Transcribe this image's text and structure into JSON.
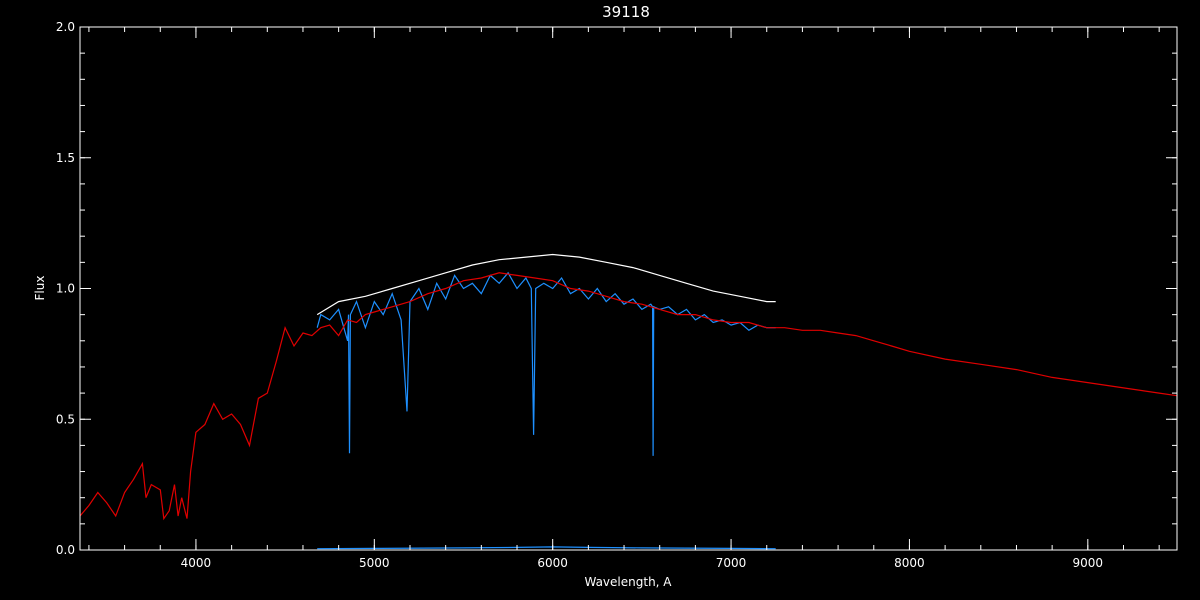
{
  "chart_data": {
    "type": "line",
    "title": "39118",
    "xlabel": "Wavelength, A",
    "ylabel": "Flux",
    "xlim": [
      3350,
      9500
    ],
    "ylim": [
      0.0,
      2.0
    ],
    "x_ticks": [
      4000,
      5000,
      6000,
      7000,
      8000,
      9000
    ],
    "x_tick_labels": [
      "4000",
      "5000",
      "6000",
      "7000",
      "8000",
      "9000"
    ],
    "x_minor_step": 200,
    "y_ticks": [
      0.0,
      0.5,
      1.0,
      1.5,
      2.0
    ],
    "y_tick_labels": [
      "0.0",
      "0.5",
      "1.0",
      "1.5",
      "2.0"
    ],
    "y_minor_step": 0.1,
    "grid": false,
    "background": "#000000",
    "axis_color": "#ffffff",
    "series": [
      {
        "color": "#ffffff",
        "style": "observed spectrum (white, under blue)",
        "x": [
          4680,
          4800,
          4950,
          5100,
          5250,
          5400,
          5550,
          5700,
          5850,
          6000,
          6150,
          6300,
          6450,
          6600,
          6750,
          6900,
          7050,
          7200,
          7250
        ],
        "y": [
          0.9,
          0.95,
          0.97,
          1.0,
          1.03,
          1.06,
          1.09,
          1.11,
          1.12,
          1.13,
          1.12,
          1.1,
          1.08,
          1.05,
          1.02,
          0.99,
          0.97,
          0.95,
          0.95
        ]
      },
      {
        "color": "#1e90ff",
        "style": "observed spectrum (blue)",
        "x": [
          4680,
          4700,
          4750,
          4800,
          4850,
          4855,
          4861,
          4866,
          4900,
          4950,
          5000,
          5050,
          5100,
          5150,
          5183,
          5200,
          5250,
          5300,
          5350,
          5400,
          5450,
          5500,
          5550,
          5600,
          5650,
          5700,
          5750,
          5800,
          5850,
          5880,
          5893,
          5905,
          5950,
          6000,
          6050,
          6100,
          6150,
          6200,
          6250,
          6300,
          6350,
          6400,
          6450,
          6500,
          6550,
          6560,
          6563,
          6566,
          6600,
          6650,
          6700,
          6750,
          6800,
          6850,
          6900,
          6950,
          7000,
          7050,
          7100,
          7150,
          7200,
          7250
        ],
        "y": [
          0.85,
          0.9,
          0.88,
          0.92,
          0.8,
          0.9,
          0.37,
          0.9,
          0.95,
          0.85,
          0.95,
          0.9,
          0.98,
          0.88,
          0.53,
          0.95,
          1.0,
          0.92,
          1.02,
          0.96,
          1.05,
          1.0,
          1.02,
          0.98,
          1.05,
          1.02,
          1.06,
          1.0,
          1.04,
          1.0,
          0.44,
          1.0,
          1.02,
          1.0,
          1.04,
          0.98,
          1.0,
          0.96,
          1.0,
          0.95,
          0.98,
          0.94,
          0.96,
          0.92,
          0.94,
          0.93,
          0.36,
          0.93,
          0.92,
          0.93,
          0.9,
          0.92,
          0.88,
          0.9,
          0.87,
          0.88,
          0.86,
          0.87,
          0.84,
          0.86,
          0.85,
          0.85
        ]
      },
      {
        "color": "#1e90ff",
        "style": "error spectrum (near zero)",
        "x": [
          4680,
          5000,
          5500,
          5800,
          6000,
          6200,
          6500,
          7000,
          7250
        ],
        "y": [
          0.005,
          0.006,
          0.008,
          0.01,
          0.012,
          0.01,
          0.008,
          0.006,
          0.005
        ]
      },
      {
        "color": "#e00000",
        "style": "model spectrum (red)",
        "x": [
          3350,
          3400,
          3450,
          3500,
          3550,
          3600,
          3650,
          3700,
          3720,
          3750,
          3800,
          3820,
          3850,
          3880,
          3900,
          3920,
          3950,
          3970,
          4000,
          4050,
          4100,
          4150,
          4200,
          4250,
          4300,
          4350,
          4400,
          4450,
          4500,
          4550,
          4600,
          4650,
          4700,
          4750,
          4800,
          4850,
          4900,
          4950,
          5000,
          5100,
          5200,
          5300,
          5400,
          5500,
          5600,
          5700,
          5800,
          5900,
          6000,
          6100,
          6200,
          6300,
          6400,
          6500,
          6600,
          6700,
          6800,
          6900,
          7000,
          7100,
          7200,
          7300,
          7400,
          7500,
          7600,
          7700,
          7800,
          7900,
          8000,
          8200,
          8400,
          8600,
          8800,
          9000,
          9200,
          9400,
          9500
        ],
        "y": [
          0.13,
          0.17,
          0.22,
          0.18,
          0.13,
          0.22,
          0.27,
          0.33,
          0.2,
          0.25,
          0.23,
          0.12,
          0.15,
          0.25,
          0.13,
          0.2,
          0.12,
          0.3,
          0.45,
          0.48,
          0.56,
          0.5,
          0.52,
          0.48,
          0.4,
          0.58,
          0.6,
          0.72,
          0.85,
          0.78,
          0.83,
          0.82,
          0.85,
          0.86,
          0.82,
          0.88,
          0.87,
          0.9,
          0.91,
          0.93,
          0.95,
          0.98,
          1.0,
          1.03,
          1.04,
          1.06,
          1.05,
          1.04,
          1.03,
          1.0,
          0.99,
          0.97,
          0.95,
          0.94,
          0.92,
          0.9,
          0.9,
          0.88,
          0.87,
          0.87,
          0.85,
          0.85,
          0.84,
          0.84,
          0.83,
          0.82,
          0.8,
          0.78,
          0.76,
          0.73,
          0.71,
          0.69,
          0.66,
          0.64,
          0.62,
          0.6,
          0.59
        ]
      }
    ]
  }
}
